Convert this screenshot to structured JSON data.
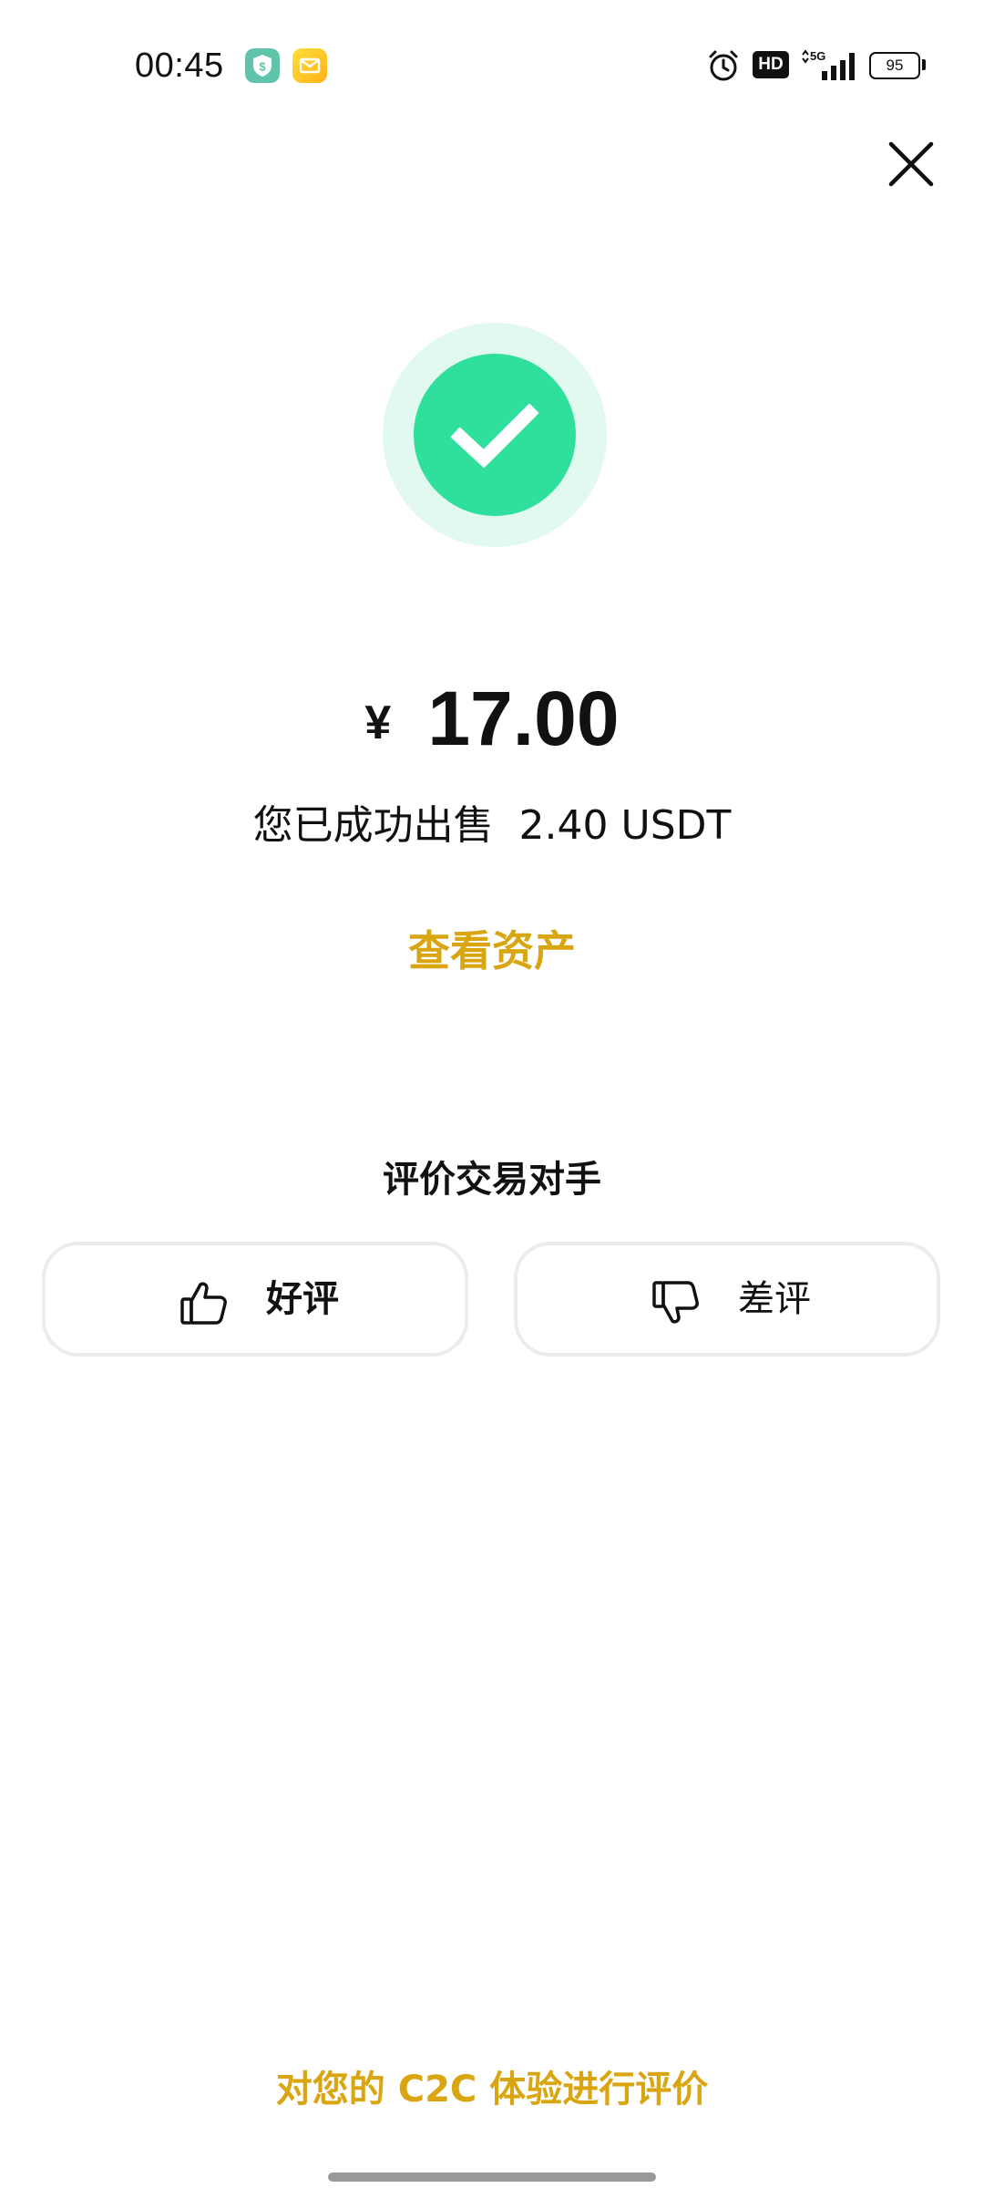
{
  "status_bar": {
    "time": "00:45",
    "hd_badge": "HD",
    "network": "5G",
    "battery": "95",
    "icons": [
      "shield-dollar-notification-icon",
      "mail-notification-icon",
      "alarm-icon",
      "hd-icon",
      "signal-icon",
      "battery-icon"
    ]
  },
  "header": {
    "close_icon": "close-icon"
  },
  "result": {
    "status_icon": "check-circle-icon",
    "currency_symbol": "¥",
    "amount": "17.00",
    "sold_message": "您已成功出售  2.40 USDT",
    "view_assets_label": "查看资产"
  },
  "rating": {
    "title": "评价交易对手",
    "good_label": "好评",
    "bad_label": "差评",
    "good_icon": "thumbs-up-icon",
    "bad_icon": "thumbs-down-icon"
  },
  "footer": {
    "feedback_label": "对您的 C2C 体验进行评价"
  },
  "colors": {
    "accent": "#d9a511",
    "success": "#2fe09c",
    "success_halo": "#e2f9ef",
    "button_border": "#ececec"
  }
}
